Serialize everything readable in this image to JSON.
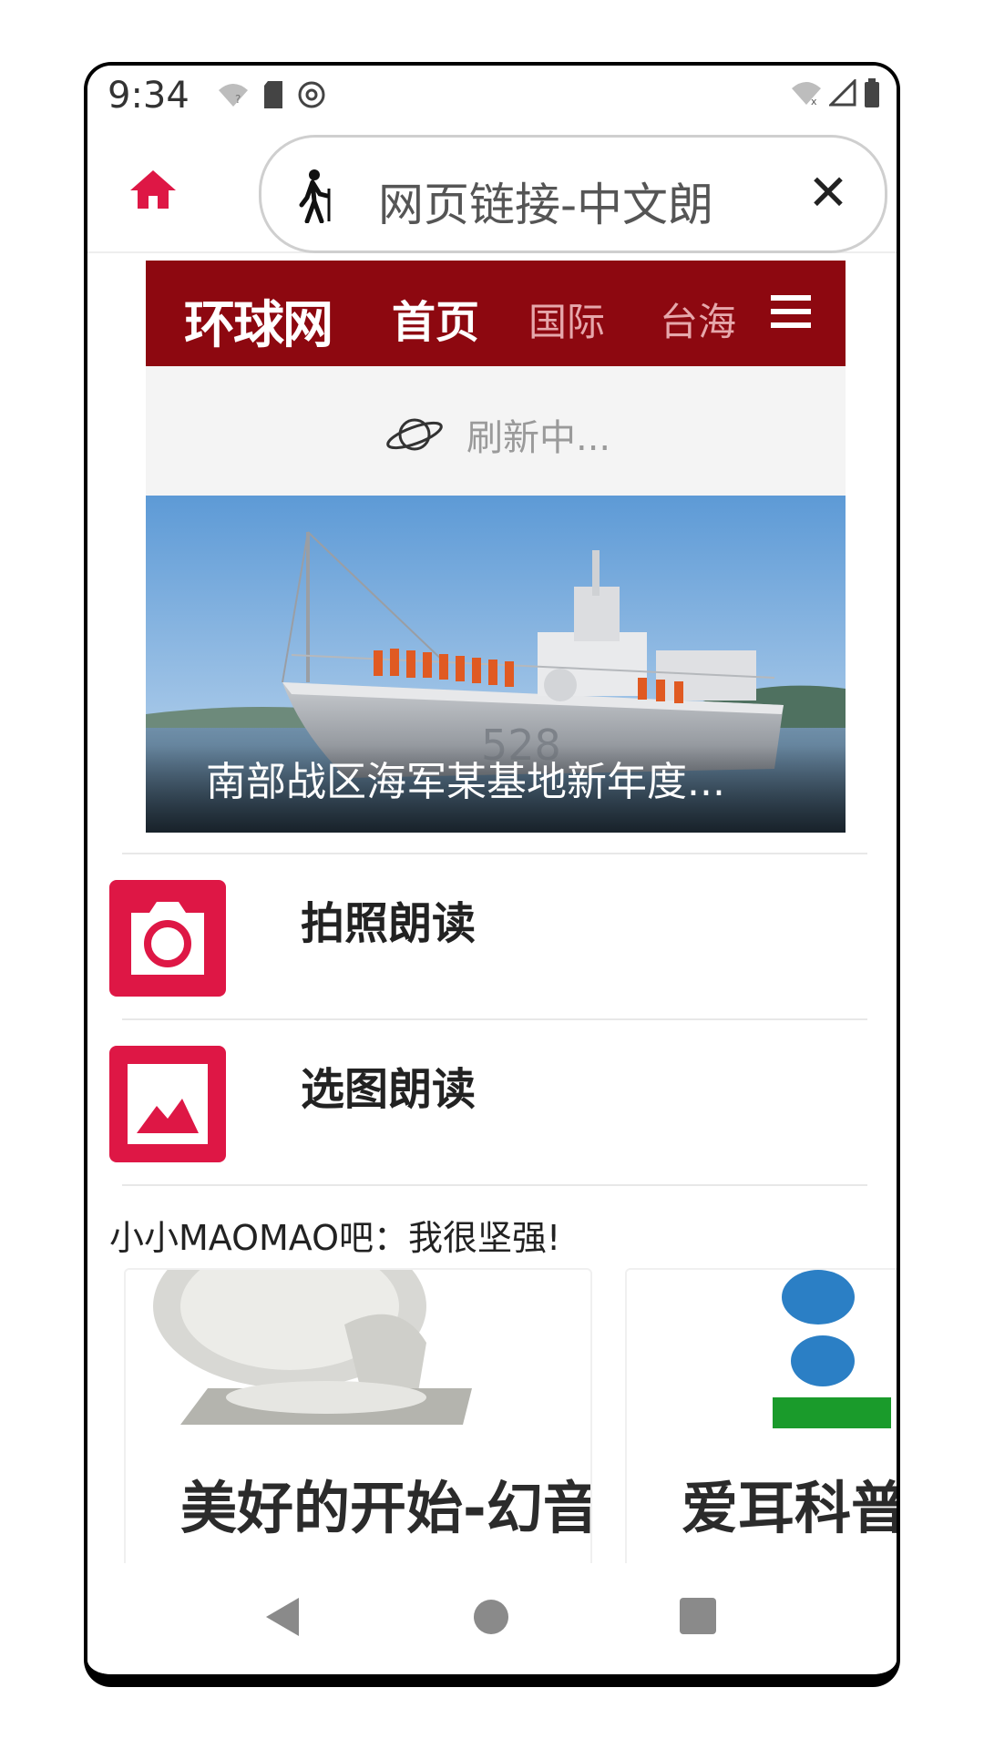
{
  "status_bar": {
    "time": "9:34"
  },
  "toolbar": {
    "home_icon": "home-icon",
    "walk_icon": "walking-person-icon",
    "speak_text": "网页链接-中文朗",
    "close_label": "✕"
  },
  "web": {
    "logo": "环球网",
    "nav_home": "首页",
    "nav_international": "国际",
    "nav_taiwan": "台海",
    "refresh_text": "刷新中...",
    "hero_caption": "南部战区海军某基地新年度...",
    "hero_ship_number": "528"
  },
  "actions": [
    {
      "label": "拍照朗读",
      "icon": "camera-icon"
    },
    {
      "label": "选图朗读",
      "icon": "image-icon"
    }
  ],
  "section": {
    "title": "小小MAOMAO吧：我很坚强!"
  },
  "cards": [
    {
      "title": "美好的开始-幻音朗读"
    },
    {
      "title": "爱耳科普大赛-是真的"
    }
  ],
  "colors": {
    "accent": "#de1745",
    "site_header": "#8d0810"
  }
}
